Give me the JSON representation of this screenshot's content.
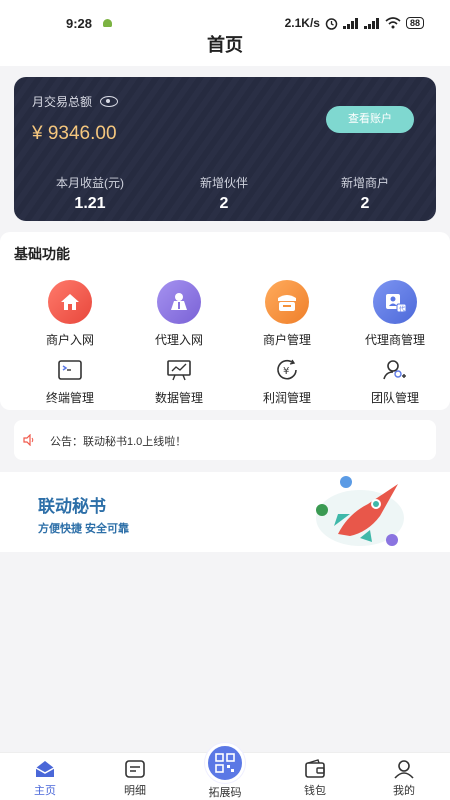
{
  "status": {
    "time": "9:28",
    "speed": "2.1K/s",
    "battery": "88"
  },
  "nav": {
    "title": "首页"
  },
  "card": {
    "label": "月交易总额",
    "amount": "¥ 9346.00",
    "view_button": "查看账户",
    "stats": [
      {
        "title": "本月收益(元)",
        "value": "1.21"
      },
      {
        "title": "新增伙伴",
        "value": "2"
      },
      {
        "title": "新增商户",
        "value": "2"
      }
    ]
  },
  "functions": {
    "heading": "基础功能",
    "row1": [
      {
        "label": "商户入网",
        "icon": "home-icon",
        "color": "#f0584a"
      },
      {
        "label": "代理入网",
        "icon": "person-icon",
        "color": "#8a74e0"
      },
      {
        "label": "商户管理",
        "icon": "shop-icon",
        "color": "#f5913a"
      },
      {
        "label": "代理商管理",
        "icon": "agent-icon",
        "color": "#5b78e5"
      }
    ],
    "row2": [
      {
        "label": "终端管理",
        "icon": "terminal-icon"
      },
      {
        "label": "数据管理",
        "icon": "chart-board-icon"
      },
      {
        "label": "利润管理",
        "icon": "yen-refresh-icon"
      },
      {
        "label": "团队管理",
        "icon": "team-add-icon"
      }
    ]
  },
  "notice": {
    "text": "公告：联动秘书1.0上线啦！"
  },
  "banner": {
    "title": "联动秘书",
    "subtitle": "方便快捷   安全可靠"
  },
  "tabbar": {
    "items": [
      {
        "label": "主页",
        "icon": "home-tab-icon"
      },
      {
        "label": "明细",
        "icon": "detail-icon"
      },
      {
        "label": "拓展码",
        "icon": "qr-code-icon"
      },
      {
        "label": "钱包",
        "icon": "wallet-icon"
      },
      {
        "label": "我的",
        "icon": "user-icon"
      }
    ]
  },
  "colors": {
    "accent": "#4a67d8",
    "card": "#2a2f45",
    "amount": "#f5c77e",
    "view_button": "#7fd8d0"
  }
}
